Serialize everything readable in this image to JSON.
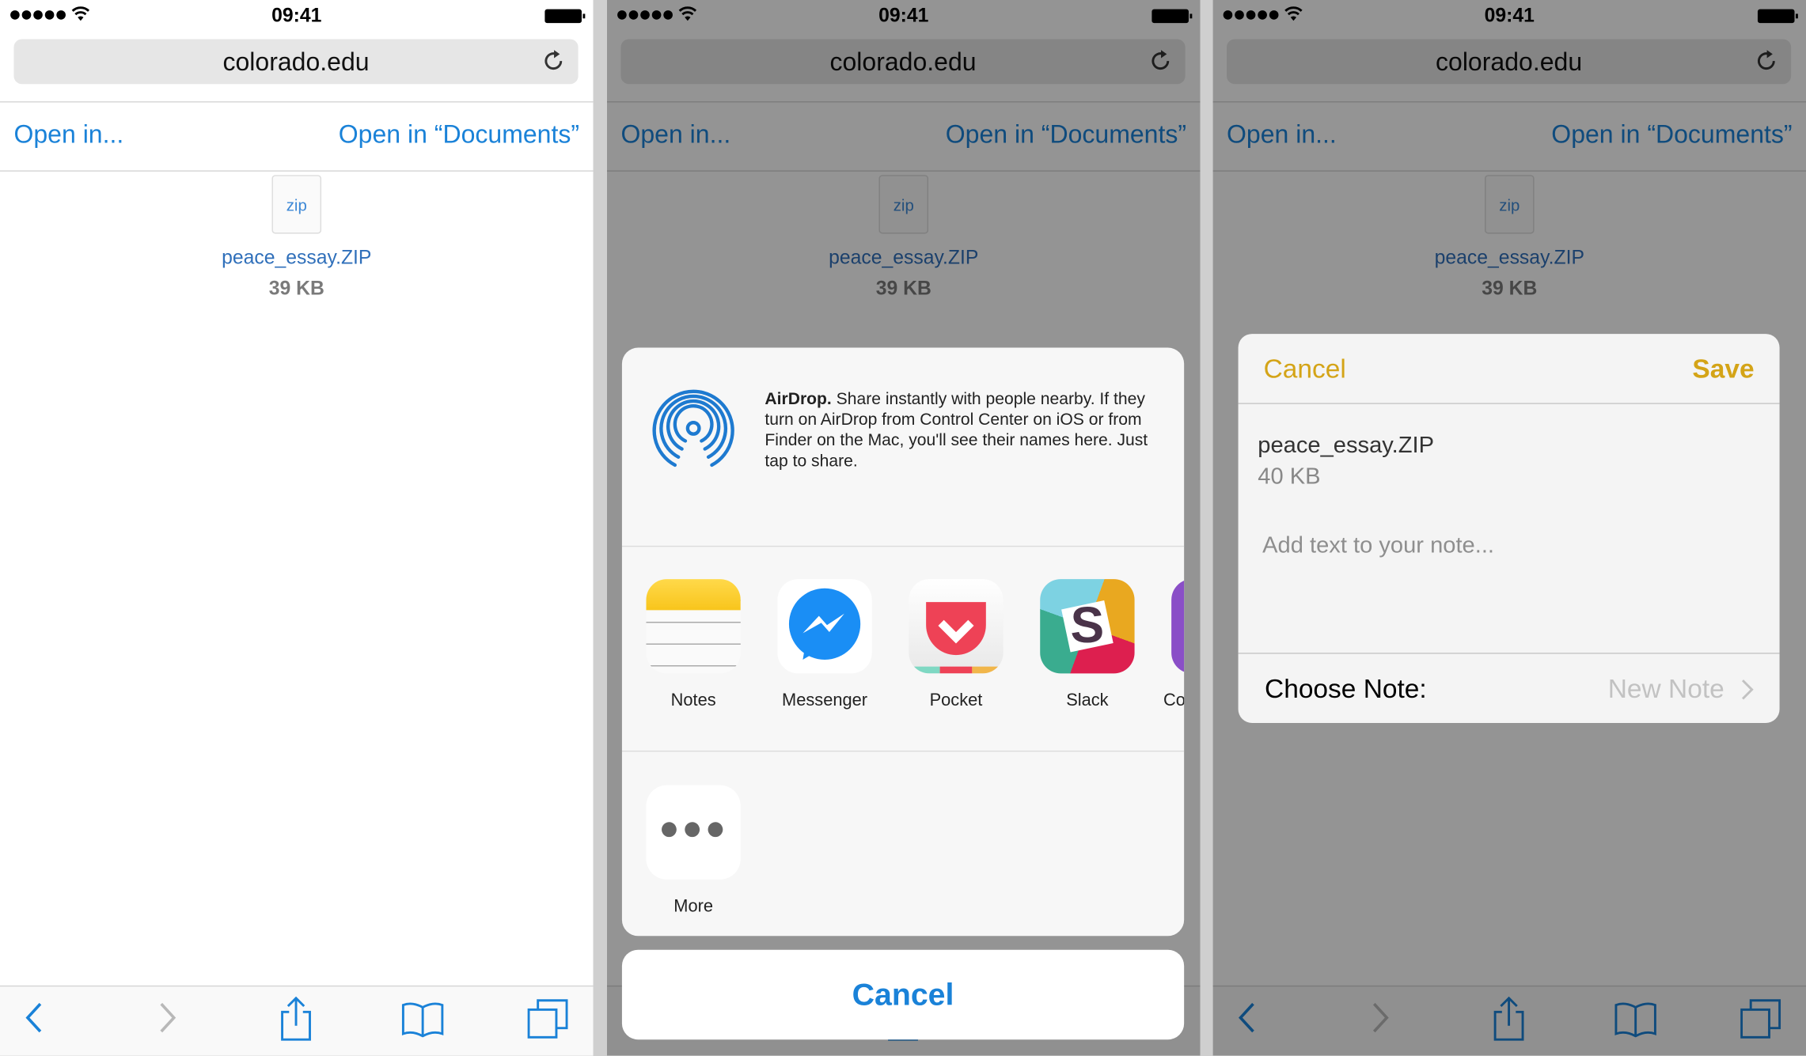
{
  "status": {
    "time": "09:41"
  },
  "browser": {
    "url": "colorado.edu",
    "open_in": "Open in...",
    "open_in_documents": "Open in “Documents”"
  },
  "file": {
    "icon_label": "zip",
    "name": "peace_essay.ZIP",
    "size": "39 KB"
  },
  "share_sheet": {
    "airdrop_title": "AirDrop.",
    "airdrop_text": " Share instantly with people nearby. If they turn on AirDrop from Control Center on iOS or from Finder on the Mac, you'll see their names here. Just tap to share.",
    "apps": [
      {
        "label": "Notes"
      },
      {
        "label": "Messenger"
      },
      {
        "label": "Pocket"
      },
      {
        "label": "Slack"
      },
      {
        "label": "Co"
      }
    ],
    "more": "More",
    "cancel": "Cancel"
  },
  "note_dialog": {
    "cancel": "Cancel",
    "save": "Save",
    "file_name": "peace_essay.ZIP",
    "file_size": "40 KB",
    "placeholder": "Add text to your note...",
    "choose_note_label": "Choose Note:",
    "choose_note_value": "New Note"
  },
  "colors": {
    "link": "#1a82d8",
    "notes_accent": "#d4a417"
  }
}
